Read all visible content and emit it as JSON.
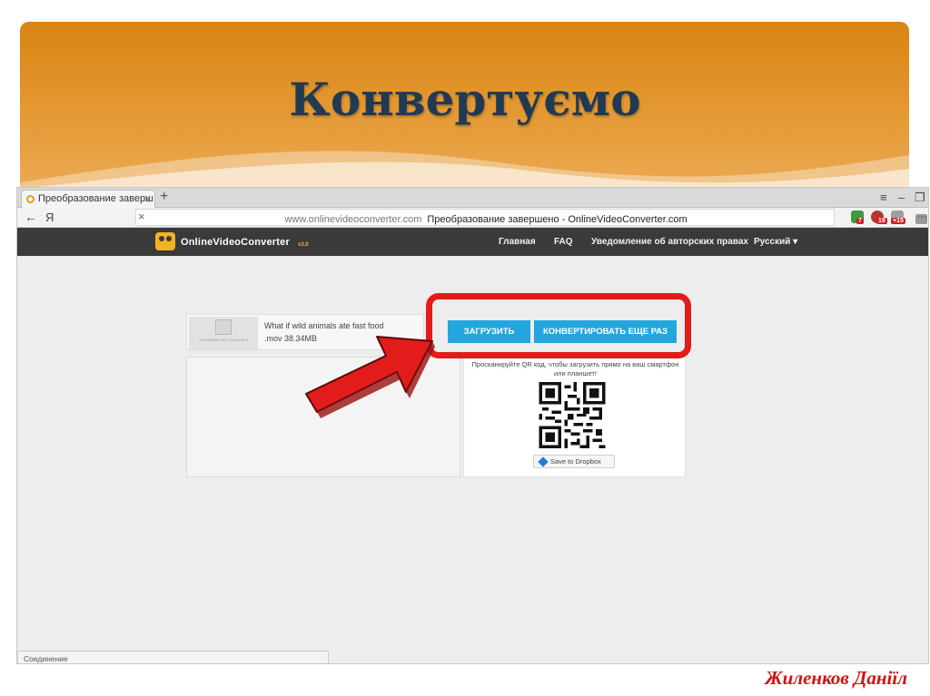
{
  "slide": {
    "title": "Конвертуємо",
    "author": "Жиленков Даніїл"
  },
  "browser": {
    "tab_title": "Преобразование заверш",
    "tab_close": "×",
    "new_tab": "+",
    "window_controls": [
      "≡",
      "‒",
      "❐"
    ],
    "back_glyph": "←",
    "yandex_glyph": "Я",
    "address_close": "×",
    "url_domain": "www.onlinevideoconverter.com",
    "url_page_title": "Преобразование завершено - OnlineVideoConverter.com",
    "extension_badges": [
      "7",
      "19",
      "+15"
    ],
    "menu_glyph": "⋯",
    "status_text": "Соединение"
  },
  "site": {
    "logo_text": "OnlineVideoConverter",
    "logo_version": "v3.0",
    "nav": {
      "home": "Главная",
      "faq": "FAQ",
      "copyright": "Уведомление об авторских правах",
      "language": "Русский ▾"
    },
    "file": {
      "name": "What if wild animals ate fast food",
      "ext_size": ".mov   38.34MB",
      "thumb_caption": "THUMBNAIL NOT AVAILABLE"
    },
    "download_button": "ЗАГРУЗИТЬ",
    "convert_again_button": "КОНВЕРТИРОВАТЬ ЕЩЕ РАЗ",
    "qr_text": "Просканируйте QR код, чтобы загрузить прямо на ваш смартфон или планшет!",
    "dropbox_button": "Save to Dropbox"
  },
  "colors": {
    "banner_orange": "#d88412",
    "title_navy": "#213a54",
    "highlight_red": "#e21b1b",
    "button_blue": "#23a6de",
    "author_red": "#d41010"
  },
  "icons": [
    "favicon-icon",
    "back-arrow-icon",
    "lock-icon",
    "star-icon",
    "extension-icon",
    "logo-camera-icon",
    "image-placeholder-icon",
    "qr-code-icon",
    "dropbox-icon",
    "red-arrow-icon"
  ]
}
